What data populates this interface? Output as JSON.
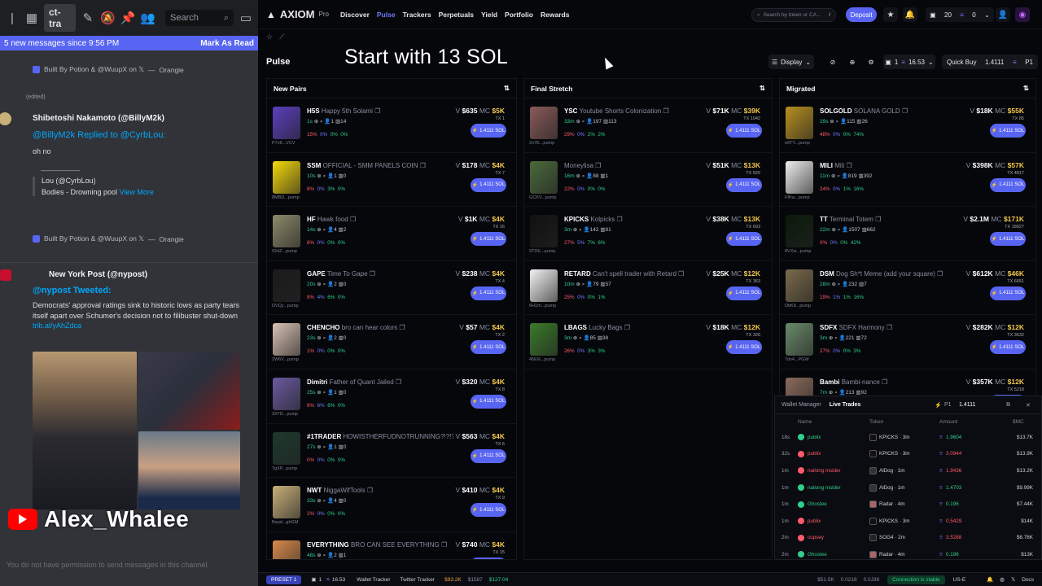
{
  "discord": {
    "channel_label": "ct-tra",
    "search_placeholder": "Search",
    "new_messages_text": "5 new messages since 9:56 PM",
    "mark_as_read": "Mark As Read",
    "built_by_1": "Built By Potion & @WuupX on 𝕏",
    "orangie_1": "Orangie",
    "edited": "(edited)",
    "author1": "Shibetoshi Nakamoto (@BillyM2k)",
    "replied_line": "@BillyM2k Replied to @CyrbLou:",
    "reply_text": "oh no",
    "dash": "——————",
    "quote_author": "Lou (@CyrbLou)",
    "quote_text": "Bodies - Drowning pool",
    "view_more": "View More",
    "built_by_2": "Built By Potion & @WuupX on 𝕏",
    "orangie_2": "Orangie",
    "author2": "New York Post (@nypost)",
    "tweeted_line": "@nypost Tweeted:",
    "tweet_text": "Democrats' approval ratings sink to historic lows as party tears itself apart over Schumer's decision not to filibuster shut-down",
    "tweet_link": "trib.al/yAhZdca",
    "watermark": "Alex_Whalee",
    "permission_text": "You do not have permission to send messages in this channel."
  },
  "axiom": {
    "brand": "AXIOM",
    "brand_sub": "Pro",
    "nav": [
      "Discover",
      "Pulse",
      "Trackers",
      "Perpetuals",
      "Yield",
      "Portfolio",
      "Rewards"
    ],
    "search_placeholder": "Search by token or CA...",
    "search_shortcut": "/",
    "deposit": "Deposit",
    "wallet_count": "20",
    "wallet_balance": "0",
    "pulse_title": "Pulse",
    "overlay_text": "Start with 13 SOL",
    "display_btn": "Display",
    "preset_count": "1",
    "sol_amount": "16.53",
    "quick_buy_label": "Quick Buy",
    "quick_buy_amount": "1.4111",
    "quick_buy_preset": "P1",
    "columns": [
      {
        "title": "New Pairs",
        "rows": [
          {
            "sym": "H5S",
            "name": "Happy 5th Solami",
            "age": "1s",
            "addr": "P7v8...VCV",
            "v": "$635",
            "mc": "$5K",
            "tx": "TX 1",
            "h": "1",
            "c": "14",
            "s1": "15%",
            "s2": "0%",
            "s3": "0%",
            "s4": "0%",
            "color": "#5b3fbf"
          },
          {
            "sym": "SSM",
            "name": "OFFICIAL - SMM PANELS COIN",
            "age": "10s",
            "addr": "8MBD...pump",
            "v": "$178",
            "mc": "$4K",
            "tx": "TX 7",
            "h": "1",
            "c": "0",
            "s1": "8%",
            "s2": "0%",
            "s3": "3%",
            "s4": "0%",
            "color": "#f5d90a"
          },
          {
            "sym": "HF",
            "name": "Hawk food",
            "age": "14s",
            "addr": "92dZ...pump",
            "v": "$1K",
            "mc": "$4K",
            "tx": "TX 16",
            "h": "4",
            "c": "2",
            "s1": "8%",
            "s2": "0%",
            "s3": "0%",
            "s4": "0%",
            "color": "#8d8a6a"
          },
          {
            "sym": "GAPE",
            "name": "Time To Gape",
            "age": "20s",
            "addr": "DVQy...pump",
            "v": "$238",
            "mc": "$4K",
            "tx": "TX 4",
            "h": "2",
            "c": "0",
            "s1": "8%",
            "s2": "4%",
            "s3": "6%",
            "s4": "0%",
            "color": "#1b1b1b"
          },
          {
            "sym": "CHENCHO",
            "name": "bro can hear colors",
            "age": "23s",
            "addr": "2W6V...pump",
            "v": "$57",
            "mc": "$4K",
            "tx": "TX 2",
            "h": "2",
            "c": "0",
            "s1": "1%",
            "s2": "0%",
            "s3": "0%",
            "s4": "0%",
            "color": "#d9c2b4"
          },
          {
            "sym": "Dimitri",
            "name": "Father of Quant Jailed",
            "age": "25s",
            "addr": "33YD...pump",
            "v": "$320",
            "mc": "$4K",
            "tx": "TX 8",
            "h": "1",
            "c": "0",
            "s1": "8%",
            "s2": "6%",
            "s3": "6%",
            "s4": "0%",
            "color": "#6a5aa0"
          },
          {
            "sym": "#1TRADER",
            "name": "HOWISTHERFUDNOTRUNNING?!?!?!?",
            "age": "27s",
            "addr": "7gXP...pump",
            "v": "$563",
            "mc": "$4K",
            "tx": "TX 6",
            "h": "1",
            "c": "0",
            "s1": "0%",
            "s2": "0%",
            "s3": "0%",
            "s4": "0%",
            "color": "#1d3a2e"
          },
          {
            "sym": "NWT",
            "name": "NiggaWifTools",
            "age": "33s",
            "addr": "Bepd...ghGM",
            "v": "$410",
            "mc": "$4K",
            "tx": "TX 9",
            "h": "4",
            "c": "0",
            "s1": "2%",
            "s2": "0%",
            "s3": "0%",
            "s4": "0%",
            "color": "#c8b07a"
          },
          {
            "sym": "EVERYTHING",
            "name": "BRO CAN SEE EVERYTHING",
            "age": "48s",
            "addr": "",
            "v": "$740",
            "mc": "$4K",
            "tx": "TX 15",
            "h": "2",
            "c": "1",
            "s1": "",
            "s2": "",
            "s3": "",
            "s4": "",
            "color": "#d88a4a"
          }
        ]
      },
      {
        "title": "Final Stretch",
        "rows": [
          {
            "sym": "YSC",
            "name": "Youtube Shorts Colonization",
            "age": "33m",
            "addr": "2n7E...pump",
            "v": "$71K",
            "mc": "$39K",
            "tx": "TX 1042",
            "h": "197",
            "c": "113",
            "s1": "29%",
            "s2": "0%",
            "s3": "2%",
            "s4": "2%",
            "color": "#8a5a5a"
          },
          {
            "sym": "",
            "name": "Moneylisa",
            "age": "16m",
            "addr": "GCKV...pump",
            "v": "$51K",
            "mc": "$13K",
            "tx": "TX 925",
            "h": "88",
            "c": "1",
            "s1": "22%",
            "s2": "0%",
            "s3": "0%",
            "s4": "0%",
            "color": "#4a6a3a"
          },
          {
            "sym": "KPICKS",
            "name": "Kolpicks",
            "age": "3m",
            "addr": "9TDE...pump",
            "v": "$38K",
            "mc": "$13K",
            "tx": "TX 693",
            "h": "142",
            "c": "81",
            "s1": "27%",
            "s2": "5%",
            "s3": "7%",
            "s4": "6%",
            "color": "#111111"
          },
          {
            "sym": "RETARD",
            "name": "Can't spell trader with Retard",
            "age": "10m",
            "addr": "6H1m...pump",
            "v": "$25K",
            "mc": "$12K",
            "tx": "TX 363",
            "h": "79",
            "c": "57",
            "s1": "25%",
            "s2": "0%",
            "s3": "0%",
            "s4": "1%",
            "color": "#f2f2f2"
          },
          {
            "sym": "LBAGS",
            "name": "Lucky Bags",
            "age": "3m",
            "addr": "45EN...pump",
            "v": "$18K",
            "mc": "$12K",
            "tx": "TX 326",
            "h": "85",
            "c": "38",
            "s1": "26%",
            "s2": "0%",
            "s3": "3%",
            "s4": "3%",
            "color": "#3a7a2a"
          }
        ]
      },
      {
        "title": "Migrated",
        "rows": [
          {
            "sym": "SOLGOLD",
            "name": "SOLANA GOLD",
            "age": "29s",
            "addr": "e9TY...pump",
            "v": "$18K",
            "mc": "$55K",
            "tx": "TX 85",
            "h": "115",
            "c": "26",
            "s1": "48%",
            "s2": "0%",
            "s3": "0%",
            "s4": "74%",
            "color": "#b89020"
          },
          {
            "sym": "MILI",
            "name": "Mili",
            "age": "11m",
            "addr": "FfKw...pump",
            "v": "$398K",
            "mc": "$57K",
            "tx": "TX 4817",
            "h": "819",
            "c": "392",
            "s1": "24%",
            "s2": "0%",
            "s3": "1%",
            "s4": "16%",
            "color": "#eeeeee"
          },
          {
            "sym": "TT",
            "name": "Terminal Totem",
            "age": "22m",
            "addr": "8VXw...pump",
            "v": "$2.1M",
            "mc": "$171K",
            "tx": "TX 18827",
            "h": "1507",
            "c": "662",
            "s1": "0%",
            "s2": "0%",
            "s3": "0%",
            "s4": "42%",
            "color": "#0a1a0a"
          },
          {
            "sym": "DSM",
            "name": "Dog Sh*t Meme (add your square)",
            "age": "28m",
            "addr": "DbK8...pump",
            "v": "$612K",
            "mc": "$46K",
            "tx": "TX 6651",
            "h": "232",
            "c": "7",
            "s1": "19%",
            "s2": "1%",
            "s3": "1%",
            "s4": "16%",
            "color": "#7a6a4a"
          },
          {
            "sym": "SDFX",
            "name": "SDFX Harmony",
            "age": "3m",
            "addr": "7dv4...PGW",
            "v": "$282K",
            "mc": "$12K",
            "tx": "TX 3632",
            "h": "221",
            "c": "72",
            "s1": "27%",
            "s2": "0%",
            "s3": "0%",
            "s4": "3%",
            "color": "#6a8a6a"
          },
          {
            "sym": "Bambi",
            "name": "Bambi-nance",
            "age": "7m",
            "addr": "",
            "v": "$357K",
            "mc": "$12K",
            "tx": "TX 5218",
            "h": "213",
            "c": "92",
            "s1": "",
            "s2": "",
            "s3": "",
            "s4": "",
            "color": "#8a6a5a"
          }
        ]
      }
    ],
    "buy_label": "1.4111 SOL",
    "live": {
      "tab_wallet": "Wallet Manager",
      "tab_live": "Live Trades",
      "preset": "P1",
      "amount": "1.4111",
      "headers": [
        "Name",
        "Token",
        "Amount",
        "$MC"
      ],
      "rows": [
        {
          "t": "18s",
          "name": "publix",
          "token": "KPICKS · 3m",
          "amt": "1.9604",
          "mc": "$13.7K",
          "buy": true,
          "tc": "#111"
        },
        {
          "t": "32s",
          "name": "publix",
          "token": "KPICKS · 3m",
          "amt": "3.0944",
          "mc": "$13.9K",
          "buy": false,
          "tc": "#111"
        },
        {
          "t": "1m",
          "name": "nailong insider",
          "token": "AlDog · 1m",
          "amt": "1.9436",
          "mc": "$13.2K",
          "buy": false,
          "tc": "#333"
        },
        {
          "t": "1m",
          "name": "nailong insider",
          "token": "AlDog · 1m",
          "amt": "1.4703",
          "mc": "$9.99K",
          "buy": true,
          "tc": "#333"
        },
        {
          "t": "1m",
          "name": "Ghostee",
          "token": "Radar · 4m",
          "amt": "0.196",
          "mc": "$7.44K",
          "buy": true,
          "tc": "#a66"
        },
        {
          "t": "1m",
          "name": "publix",
          "token": "KPICKS · 3m",
          "amt": "0.5429",
          "mc": "$14K",
          "buy": false,
          "tc": "#111"
        },
        {
          "t": "2m",
          "name": "cupsey",
          "token": "SOG4 · 2m",
          "amt": "3.5288",
          "mc": "$6.76K",
          "buy": false,
          "tc": "#222"
        },
        {
          "t": "2m",
          "name": "Ghostee",
          "token": "Radar · 4m",
          "amt": "0.196",
          "mc": "$13K",
          "buy": true,
          "tc": "#a66"
        }
      ]
    },
    "bottom": {
      "preset": "PRESET 1",
      "presets_count": "1",
      "sol": "16.53",
      "wallet_tracker": "Wallet Tracker",
      "twitter_tracker": "Twitter Tracker",
      "btc": "$93.2K",
      "eth": "$1587",
      "sol_price": "$127.04",
      "vol1": "$51.5K",
      "vol2": "0.0218",
      "vol3": "0.0J38",
      "connection": "Connection is stable",
      "region": "US-E",
      "docs": "Docs"
    }
  }
}
